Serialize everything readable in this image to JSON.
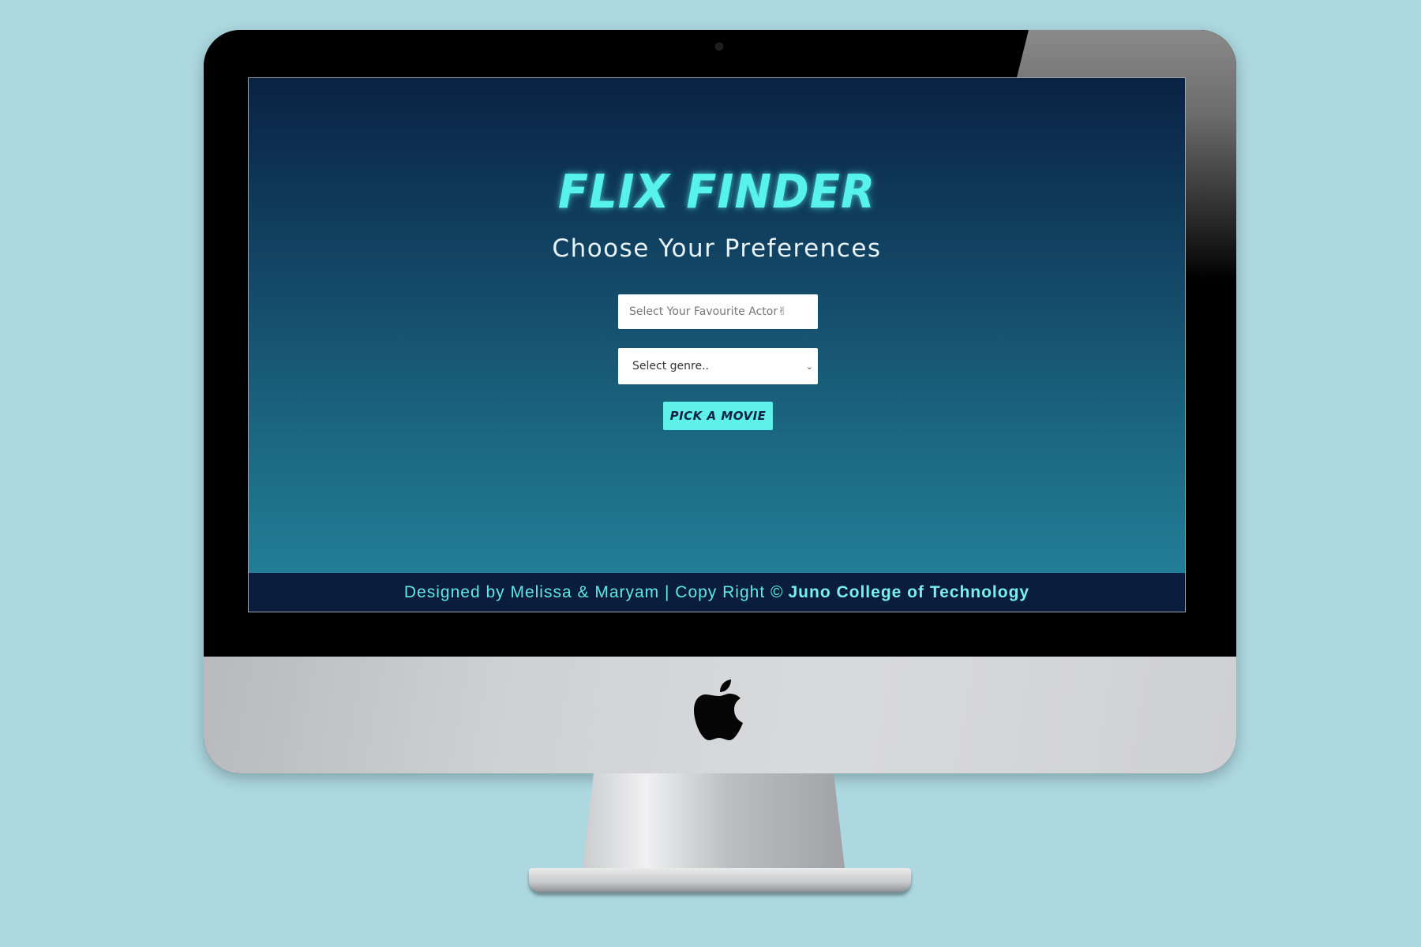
{
  "app": {
    "title": "FLIX FINDER",
    "subtitle": "Choose Your Preferences"
  },
  "form": {
    "actor_placeholder": "Select Your Favourite Actor✌",
    "actor_value": "",
    "genre_selected": "Select genre..",
    "submit_label": "PICK A MOVIE"
  },
  "footer": {
    "text": "Designed by Melissa & Maryam | Copy Right ©",
    "link_label": "Juno College of Technology"
  },
  "icons": {
    "genre_dropdown": "chevron-down-icon",
    "device_logo": "apple-logo-icon",
    "camera": "webcam-icon"
  },
  "colors": {
    "backdrop": "#add8e0",
    "accent": "#5ff0ea",
    "page_gradient_top": "#0a2244",
    "page_gradient_bottom": "#23849c",
    "footer_bg": "#0a1d3e"
  }
}
